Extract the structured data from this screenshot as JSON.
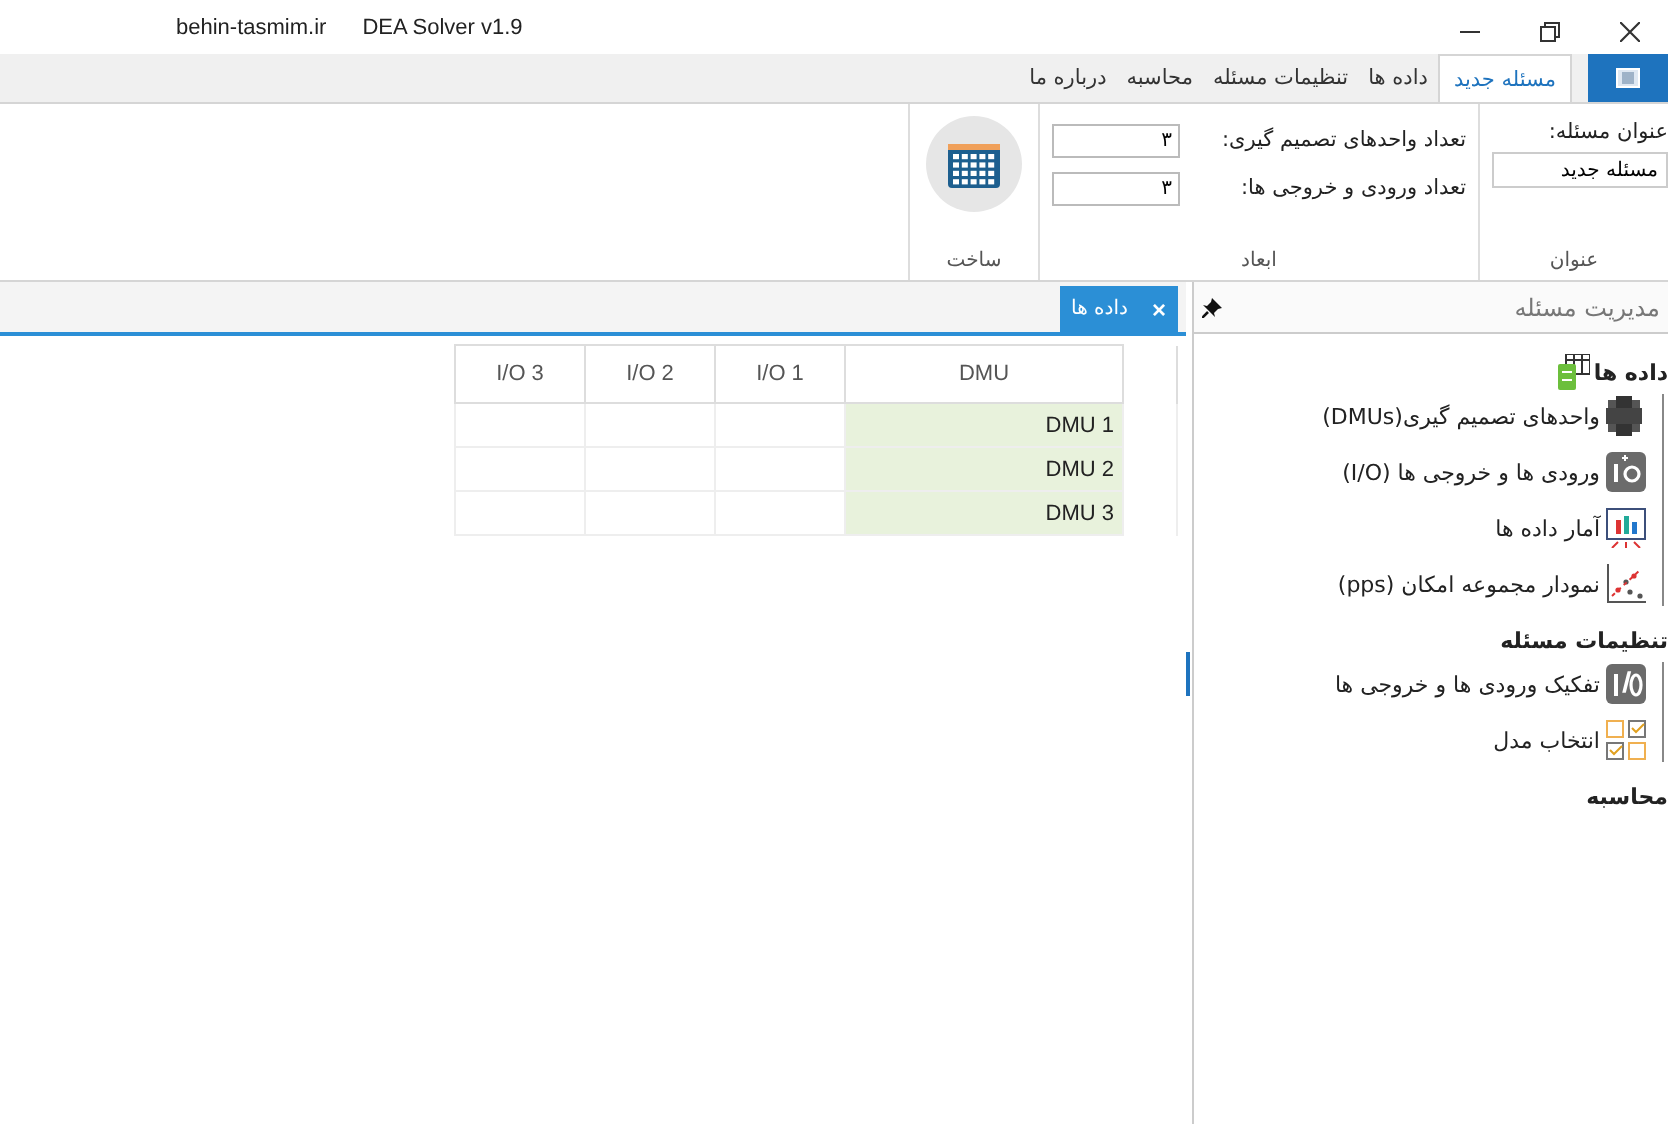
{
  "window": {
    "site": "behin-tasmim.ir",
    "title": "DEA Solver v1.9"
  },
  "ribbon_tabs": [
    {
      "label": "مسئله جدید",
      "selected": true
    },
    {
      "label": "داده ها",
      "selected": false
    },
    {
      "label": "تنظیمات مسئله",
      "selected": false
    },
    {
      "label": "محاسبه",
      "selected": false
    },
    {
      "label": "درباره ما",
      "selected": false
    }
  ],
  "ribbon": {
    "title_group": {
      "label": "عنوان مسئله:",
      "value": "مسئله جدید",
      "caption": "عنوان"
    },
    "dimensions_group": {
      "fields": [
        {
          "label": "تعداد واحدهای تصمیم گیری:",
          "value": "۳"
        },
        {
          "label": "تعداد ورودی و خروجی ها:",
          "value": "۳"
        }
      ],
      "caption": "ابعاد"
    },
    "build_group": {
      "caption": "ساخت"
    }
  },
  "document_tabs": [
    {
      "label": "داده ها",
      "selected": true,
      "close": "×"
    }
  ],
  "table": {
    "columns": [
      "DMU",
      "I/O 1",
      "I/O 2",
      "I/O 3"
    ],
    "rows": [
      "DMU 1",
      "DMU 2",
      "DMU 3"
    ]
  },
  "panel": {
    "title": "مدیریت مسئله",
    "tree": [
      {
        "label": "داده ها",
        "children": [
          {
            "label": "واحدهای تصمیم گیری(DMUs)"
          },
          {
            "label": "ورودی ها و خروجی ها (I/O)"
          },
          {
            "label": "آمار داده ها"
          },
          {
            "label": "نمودار مجموعه امکان (pps)"
          }
        ]
      },
      {
        "label": "تنظیمات مسئله",
        "children": [
          {
            "label": "تفکیک ورودی ها و خروجی ها"
          },
          {
            "label": "انتخاب مدل"
          }
        ]
      },
      {
        "label": "محاسبه"
      }
    ]
  }
}
